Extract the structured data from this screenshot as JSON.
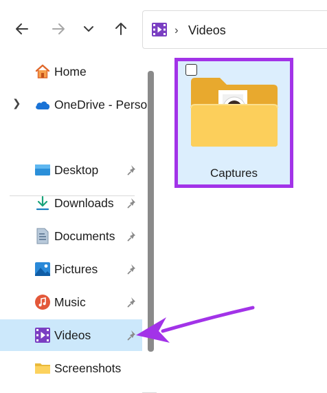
{
  "toolbar": {
    "back_icon": "arrow-left-icon",
    "forward_icon": "arrow-right-icon",
    "recent_icon": "chevron-down-icon",
    "up_icon": "arrow-up-icon"
  },
  "address_bar": {
    "icon": "videos-folder-icon",
    "separator": "›",
    "path": "Videos"
  },
  "sidebar": {
    "home": "Home",
    "onedrive": "OneDrive - Perso",
    "quick_access": [
      {
        "label": "Desktop",
        "icon": "desktop-icon",
        "pinned": true
      },
      {
        "label": "Downloads",
        "icon": "download-icon",
        "pinned": true
      },
      {
        "label": "Documents",
        "icon": "document-icon",
        "pinned": true
      },
      {
        "label": "Pictures",
        "icon": "pictures-icon",
        "pinned": true
      },
      {
        "label": "Music",
        "icon": "music-icon",
        "pinned": true
      },
      {
        "label": "Videos",
        "icon": "videos-icon",
        "pinned": true,
        "selected": true
      },
      {
        "label": "Screenshots",
        "icon": "folder-icon",
        "pinned": false
      }
    ]
  },
  "content": {
    "items": [
      {
        "name": "Captures",
        "type": "folder",
        "selected": true
      }
    ]
  },
  "colors": {
    "highlight": "#a233e8",
    "selection": "#cce8fb",
    "tile_bg": "#dceefd"
  }
}
